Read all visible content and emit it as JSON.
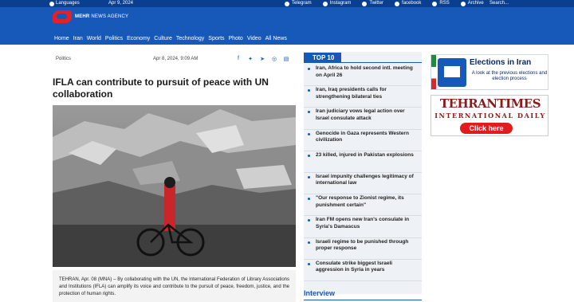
{
  "topbar": {
    "languages": "Languages",
    "date": "Apr 9, 2024",
    "social": [
      {
        "label": "Telegram",
        "icon": "telegram-icon"
      },
      {
        "label": "Instagram",
        "icon": "instagram-icon"
      },
      {
        "label": "Twitter",
        "icon": "twitter-icon"
      },
      {
        "label": "facebook",
        "icon": "facebook-icon"
      },
      {
        "label": "RSS",
        "icon": "rss-icon"
      },
      {
        "label": "Archive",
        "icon": "archive-icon"
      }
    ],
    "search_placeholder": "Search..."
  },
  "brand": {
    "name": "MEHR",
    "sub": "NEWS AGENCY",
    "colors": {
      "header": "#1659b8",
      "topstrip": "#0a3f8f",
      "logo": "#e2222a"
    }
  },
  "nav": [
    "Home",
    "Iran",
    "World",
    "Politics",
    "Economy",
    "Culture",
    "Technology",
    "Sports",
    "Photo",
    "Video",
    "All News"
  ],
  "article": {
    "category": "Politics",
    "date": "Apr 8, 2024, 9:09 AM",
    "title": "IFLA can contribute to pursuit of peace with UN collaboration",
    "lead": "TEHRAN, Apr. 08 (MNA) – By collaborating with the UN, the International Federation of Library Associations and Institutions (IFLA) can amplify its voice and contribute to the pursuit of peace, freedom, justice, and the protection of human rights."
  },
  "top10": {
    "title": "TOP 10",
    "items": [
      "Iran, Africa to hold second intl. meeting on April 26",
      "Iran, Iraq presidents calls for strengthening bilateral ties",
      "Iran judiciary vows legal action over Israel consulate attack",
      "Genocide in Gaza represents Western civilization",
      "23 killed, injured in Pakistan explosions",
      "Israel impunity challenges legitimacy of international law",
      "\"Our response to Zionist regime, its punishment certain\"",
      "Iran FM opens new Iran's consulate in Syria's Damascus",
      "Israeli regime to be punished through proper response",
      "Consulate strike biggest Israeli aggression in Syria in years"
    ]
  },
  "interview": {
    "title": "Interview"
  },
  "ads": {
    "elections": {
      "heading": "Elections in Iran",
      "sub": "A look at the previous elections and election process"
    },
    "tehrantimes": {
      "line1": "TEHRANTIMES",
      "line2": "INTERNATIONAL DAILY",
      "cta": "Click here"
    }
  }
}
